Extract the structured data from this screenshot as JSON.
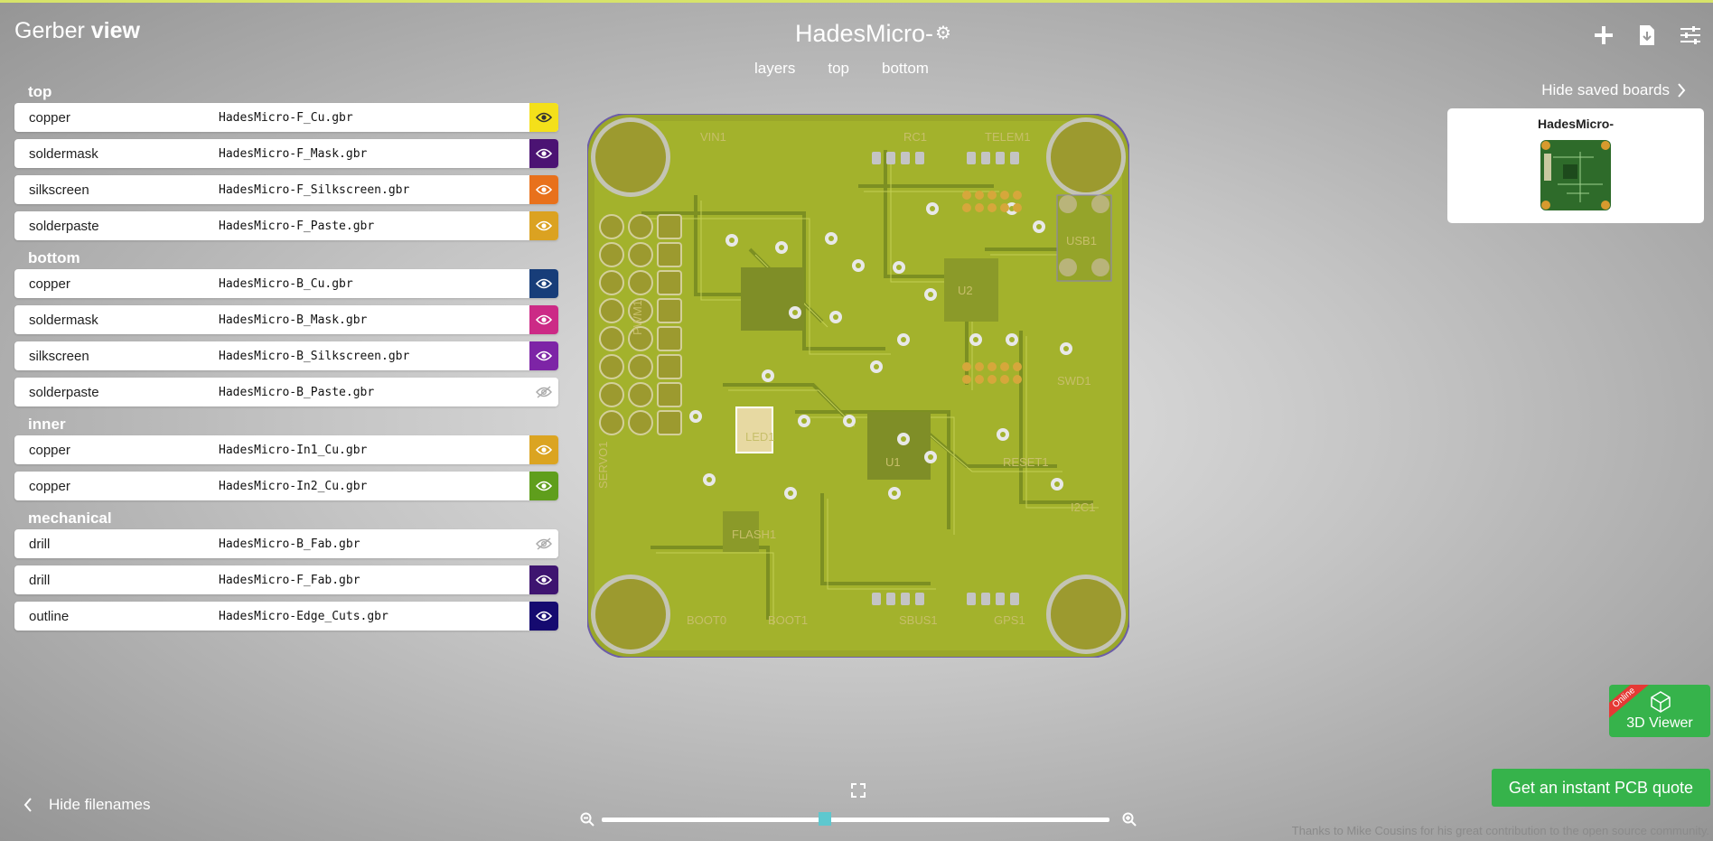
{
  "app": {
    "brand_light": "Gerber",
    "brand_bold": "view"
  },
  "board": {
    "title": "HadesMicro-"
  },
  "tabs": [
    {
      "label": "layers",
      "active": true
    },
    {
      "label": "top",
      "active": false
    },
    {
      "label": "bottom",
      "active": false
    }
  ],
  "header_actions": [
    "plus-icon",
    "download-icon",
    "sliders-icon"
  ],
  "layer_groups": [
    {
      "label": "top",
      "layers": [
        {
          "name": "copper",
          "file": "HadesMicro-F_Cu.gbr",
          "color": "#f4e01a",
          "visible": true
        },
        {
          "name": "soldermask",
          "file": "HadesMicro-F_Mask.gbr",
          "color": "#4b1373",
          "visible": true
        },
        {
          "name": "silkscreen",
          "file": "HadesMicro-F_Silkscreen.gbr",
          "color": "#e8711c",
          "visible": true
        },
        {
          "name": "solderpaste",
          "file": "HadesMicro-F_Paste.gbr",
          "color": "#dba221",
          "visible": true
        }
      ]
    },
    {
      "label": "bottom",
      "layers": [
        {
          "name": "copper",
          "file": "HadesMicro-B_Cu.gbr",
          "color": "#173d79",
          "visible": true
        },
        {
          "name": "soldermask",
          "file": "HadesMicro-B_Mask.gbr",
          "color": "#cc2a86",
          "visible": true
        },
        {
          "name": "silkscreen",
          "file": "HadesMicro-B_Silkscreen.gbr",
          "color": "#7d24a6",
          "visible": true
        },
        {
          "name": "solderpaste",
          "file": "HadesMicro-B_Paste.gbr",
          "color": "#ffffff",
          "visible": false
        }
      ]
    },
    {
      "label": "inner",
      "layers": [
        {
          "name": "copper",
          "file": "HadesMicro-In1_Cu.gbr",
          "color": "#dba421",
          "visible": true
        },
        {
          "name": "copper",
          "file": "HadesMicro-In2_Cu.gbr",
          "color": "#5f9e1c",
          "visible": true
        }
      ]
    },
    {
      "label": "mechanical",
      "layers": [
        {
          "name": "drill",
          "file": "HadesMicro-B_Fab.gbr",
          "color": "#ffffff",
          "visible": false
        },
        {
          "name": "drill",
          "file": "HadesMicro-F_Fab.gbr",
          "color": "#3e1470",
          "visible": true
        },
        {
          "name": "outline",
          "file": "HadesMicro-Edge_Cuts.gbr",
          "color": "#150a70",
          "visible": true
        }
      ]
    }
  ],
  "saved_boards": {
    "toggle_label": "Hide saved boards",
    "items": [
      {
        "title": "HadesMicro-"
      }
    ]
  },
  "pcb_labels": [
    "VIN1",
    "TELEM1",
    "RC1",
    "USB1",
    "SWD1",
    "RESET1",
    "SERVO1",
    "BOOT0",
    "BOOT1",
    "SBUS1",
    "GPS1",
    "FLASH1",
    "I2C1",
    "U2",
    "PWM1",
    "U1",
    "LED1"
  ],
  "zoom": {
    "level": 0.44
  },
  "footer": {
    "hide_filenames": "Hide filenames",
    "viewer3d_label": "3D Viewer",
    "viewer3d_ribbon": "Online",
    "quote_button": "Get an instant PCB quote",
    "thanks": "Thanks to Mike Cousins for his great contribution to the open source community."
  }
}
